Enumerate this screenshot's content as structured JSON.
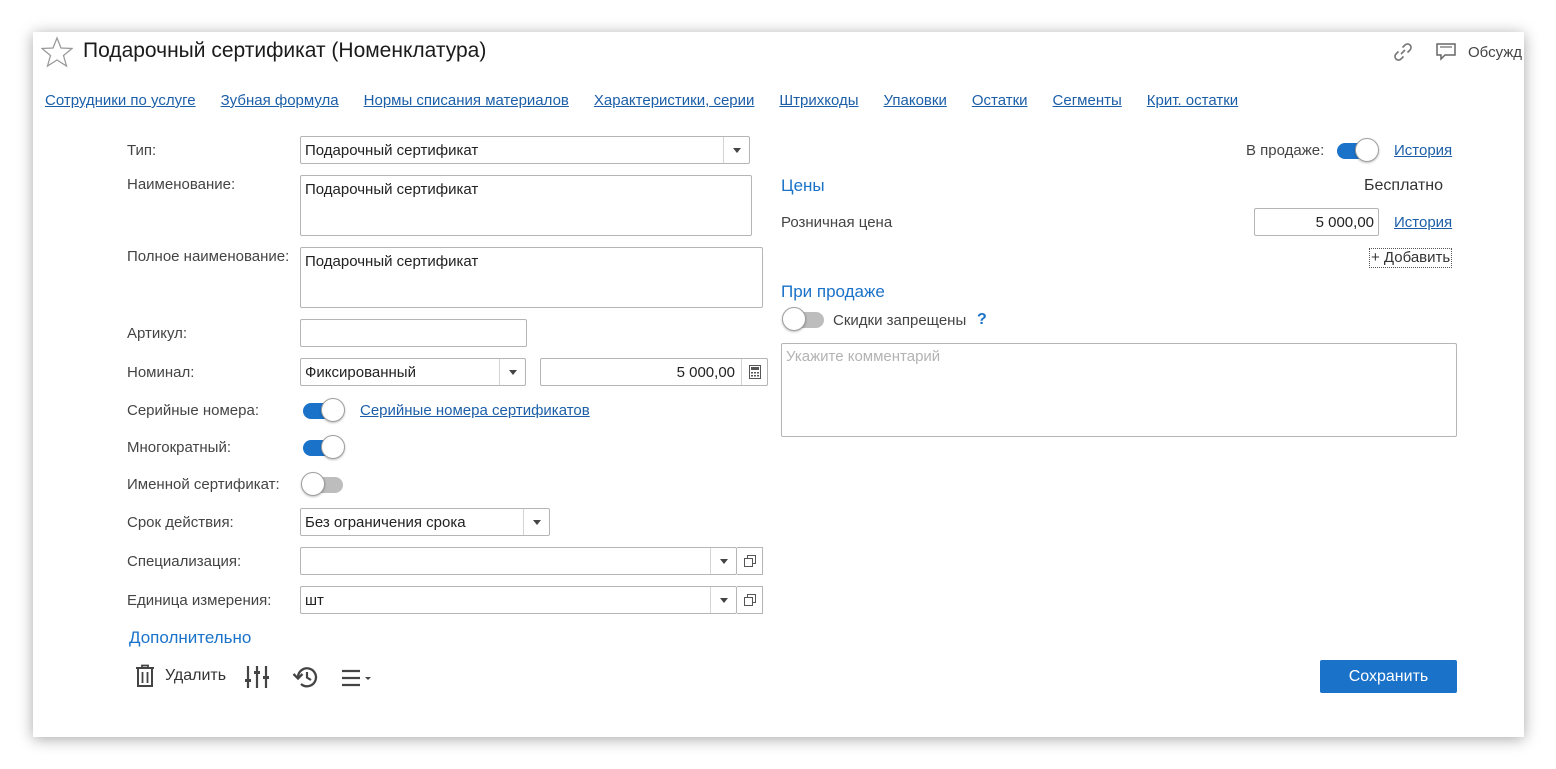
{
  "header": {
    "title": "Подарочный сертификат (Номенклатура)",
    "favorite_icon": "star-icon",
    "link_icon": "link-icon",
    "discuss_label": "Обсужд"
  },
  "tabs": [
    "Сотрудники по услуге",
    "Зубная формула",
    "Нормы списания материалов",
    "Характеристики, серии",
    "Штрихкоды",
    "Упаковки",
    "Остатки",
    "Сегменты",
    "Крит. остатки"
  ],
  "form": {
    "type_label": "Тип:",
    "type_value": "Подарочный сертификат",
    "name_label": "Наименование:",
    "name_value": "Подарочный сертификат",
    "fullname_label": "Полное наименование:",
    "fullname_value": "Подарочный сертификат",
    "article_label": "Артикул:",
    "article_value": "",
    "nominal_label": "Номинал:",
    "nominal_type": "Фиксированный",
    "nominal_amount": "5 000,00",
    "serial_label": "Серийные номера:",
    "serial_on": true,
    "serial_link": "Серийные номера сертификатов",
    "multiple_label": "Многократный:",
    "multiple_on": true,
    "named_label": "Именной сертификат:",
    "named_on": false,
    "validity_label": "Срок действия:",
    "validity_value": "Без ограничения срока",
    "spec_label": "Специализация:",
    "spec_value": "",
    "unit_label": "Единица измерения:",
    "unit_value": "шт",
    "additional": "Дополнительно"
  },
  "right": {
    "on_sale_label": "В продаже:",
    "on_sale_on": true,
    "history_label": "История",
    "prices_title": "Цены",
    "free_label": "Бесплатно",
    "retail_label": "Розничная цена",
    "retail_value": "5 000,00",
    "retail_history": "История",
    "add_label": "+ Добавить",
    "on_sale_section": "При продаже",
    "discounts_label": "Скидки запрещены",
    "discounts_on": false,
    "help_mark": "?",
    "comment_placeholder": "Укажите комментарий"
  },
  "toolbar": {
    "delete_label": "Удалить",
    "save_label": "Сохранить"
  },
  "colors": {
    "accent": "#1a72c9",
    "link": "#1c5fa8"
  }
}
